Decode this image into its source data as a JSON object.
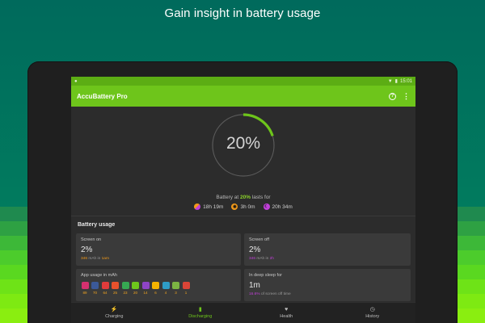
{
  "headline": "Gain insight in battery usage",
  "colors": {
    "accent": "#6ec51b",
    "accent_dark": "#5cad14",
    "orange": "#f29a1a",
    "purple": "#c040d8",
    "background_teal": "#006a5c",
    "bands": [
      "#1f8a4f",
      "#2ea143",
      "#3db838",
      "#4ccc2c",
      "#5ad820",
      "#6ee317",
      "#7eea12",
      "#8aee10"
    ]
  },
  "status_bar": {
    "left_icon": "android-icon",
    "time": "15:01"
  },
  "app_bar": {
    "title": "AccuBattery Pro",
    "help_icon": "help-icon",
    "more_icon": "more-vert-icon"
  },
  "gauge": {
    "percent_text": "20%",
    "level": 0.2
  },
  "summary": {
    "prefix": "Battery at ",
    "percent": "20%",
    "suffix": " lasts for",
    "durations": [
      {
        "icon": "screen-on-icon",
        "value": "18h 19m"
      },
      {
        "icon": "combined-icon",
        "value": "3h 0m"
      },
      {
        "icon": "deep-sleep-icon",
        "value": "20h 34m"
      }
    ]
  },
  "battery_usage": {
    "title": "Battery usage",
    "screen_on": {
      "label": "Screen on",
      "value": "2%",
      "mah": "346",
      "mah_mid": " mAh in ",
      "duration": "1am"
    },
    "screen_off": {
      "label": "Screen off",
      "value": "2%",
      "mah": "346",
      "mah_mid": " mAh in ",
      "duration": "2h"
    },
    "app_usage": {
      "label": "App usage in mAh",
      "apps": [
        {
          "icon": "instagram-icon",
          "color": "#d6306f",
          "value": "89"
        },
        {
          "icon": "facebook-icon",
          "color": "#3b5998",
          "value": "70"
        },
        {
          "icon": "pokeball-icon",
          "color": "#e03b3b",
          "value": "64"
        },
        {
          "icon": "chrome-like-icon",
          "color": "#e8512c",
          "value": "25"
        },
        {
          "icon": "maps-icon",
          "color": "#36a852",
          "value": "23"
        },
        {
          "icon": "shield-icon",
          "color": "#6ec51b",
          "value": "20"
        },
        {
          "icon": "messages-icon",
          "color": "#8e44c6",
          "value": "14"
        },
        {
          "icon": "drive-icon",
          "color": "#f4b400",
          "value": "6"
        },
        {
          "icon": "n-icon",
          "color": "#2e9cc6",
          "value": "4"
        },
        {
          "icon": "android-icon",
          "color": "#7cb342",
          "value": "3"
        },
        {
          "icon": "chrome-icon",
          "color": "#db4437",
          "value": "1"
        }
      ]
    },
    "deep_sleep": {
      "label": "In deep sleep for",
      "value": "1m",
      "sub_pct": "16.6%",
      "sub_text": " of screen off time"
    }
  },
  "bottom_nav": [
    {
      "label": "Charging",
      "icon": "charging-icon"
    },
    {
      "label": "Discharging",
      "icon": "discharging-icon"
    },
    {
      "label": "Health",
      "icon": "heart-icon"
    },
    {
      "label": "History",
      "icon": "history-icon"
    }
  ],
  "active_tab_index": 1
}
